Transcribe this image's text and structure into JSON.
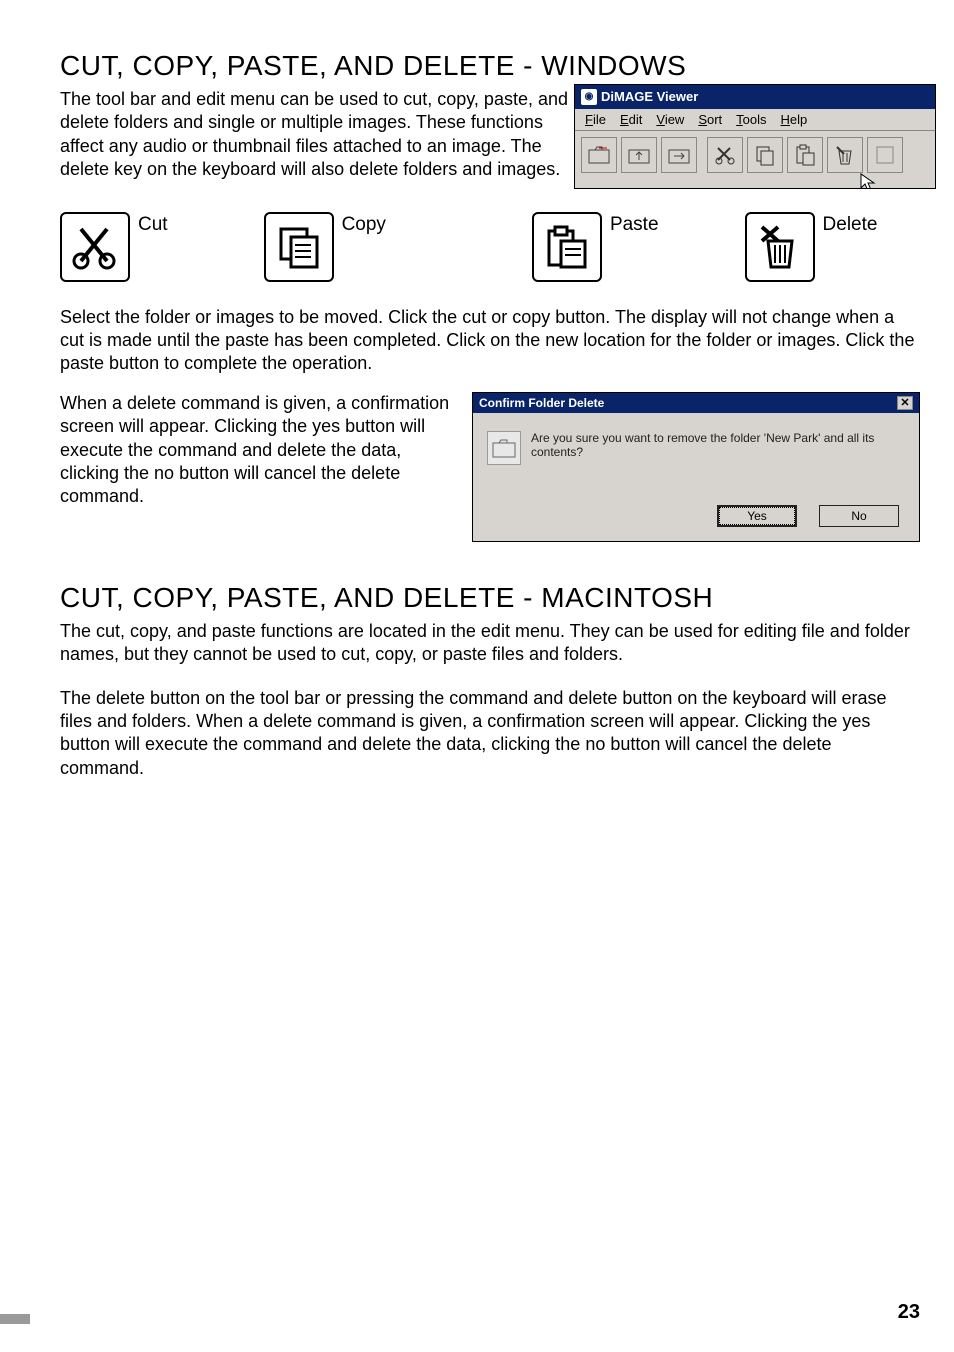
{
  "section1": {
    "heading": "CUT, COPY, PASTE, AND DELETE - WINDOWS",
    "intro": "The tool bar and edit menu can be used to cut, copy, paste, and delete folders and single or multiple images. These functions affect any audio or thumbnail files attached to an image. The delete key on the keyboard will also delete folders and images.",
    "window": {
      "title": "DiMAGE Viewer",
      "menus": [
        "File",
        "Edit",
        "View",
        "Sort",
        "Tools",
        "Help"
      ]
    },
    "icons": {
      "cut": "Cut",
      "copy": "Copy",
      "paste": "Paste",
      "delete": "Delete"
    },
    "para2": "Select the folder or images to be moved. Click the cut or copy button. The display will not change when a cut is made until the paste has been completed. Click on the new location for the folder or images. Click the paste button to complete the operation.",
    "delete_text": "When a delete command is given, a confirmation screen will appear. Clicking the yes button will execute the command and delete the data, clicking the no button will cancel the delete command.",
    "dialog": {
      "title": "Confirm Folder Delete",
      "message": "Are you sure you want to remove the folder 'New Park' and all its contents?",
      "yes": "Yes",
      "no": "No"
    }
  },
  "section2": {
    "heading": "CUT, COPY, PASTE, AND DELETE - MACINTOSH",
    "para1": "The cut, copy, and paste functions are located in the edit menu. They can be used for editing file and folder names, but they cannot be used to cut, copy, or paste files and folders.",
    "para2": "The delete button on the tool bar or pressing the command and delete button on the keyboard will erase files and folders. When a delete command is given, a confirmation screen will appear. Clicking the yes button will execute the command and delete the data, clicking the no button will cancel the delete command."
  },
  "page_number": "23"
}
